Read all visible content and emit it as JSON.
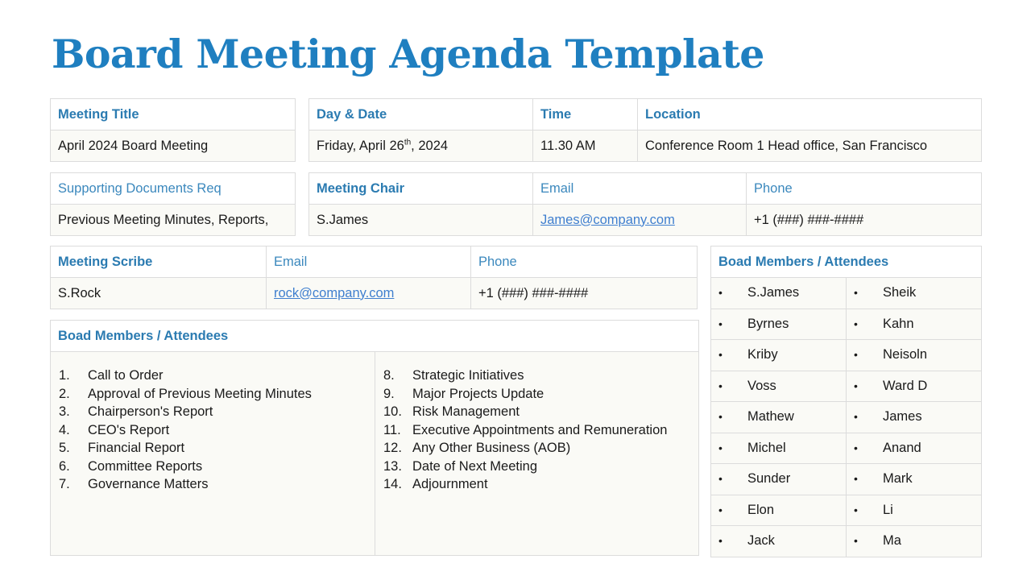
{
  "page": {
    "title": "Board Meeting Agenda Template"
  },
  "meeting_title": {
    "label": "Meeting Title",
    "value": "April  2024 Board Meeting"
  },
  "schedule": {
    "date_label": "Day & Date",
    "date_prefix": "Friday, April 26",
    "date_suffix": "th",
    "date_rest": ", 2024",
    "time_label": "Time",
    "time_value": "11.30 AM",
    "location_label": "Location",
    "location_value": "Conference Room 1 Head office, San Francisco"
  },
  "supporting_docs": {
    "label": "Supporting Documents Req",
    "value": "Previous Meeting Minutes, Reports,"
  },
  "chair": {
    "label": "Meeting Chair",
    "name": "S.James",
    "email_label": "Email",
    "email": "James@company.com",
    "phone_label": "Phone",
    "phone": "+1 (###) ###-####"
  },
  "scribe": {
    "label": "Meeting Scribe",
    "name": "S.Rock",
    "email_label": "Email",
    "email": "rock@company.com",
    "phone_label": "Phone",
    "phone": "+1 (###) ###-####"
  },
  "agenda": {
    "heading": "Boad Members / Attendees",
    "left": [
      {
        "num": "1.",
        "text": "Call to Order"
      },
      {
        "num": "2.",
        "text": "Approval of Previous Meeting Minutes"
      },
      {
        "num": "3.",
        "text": "Chairperson's Report"
      },
      {
        "num": "4.",
        "text": "CEO's Report"
      },
      {
        "num": "5.",
        "text": "Financial Report"
      },
      {
        "num": "6.",
        "text": "Committee Reports"
      },
      {
        "num": "7.",
        "text": "Governance Matters"
      }
    ],
    "right": [
      {
        "num": "8.",
        "text": "Strategic Initiatives"
      },
      {
        "num": "9.",
        "text": "Major Projects Update"
      },
      {
        "num": "10.",
        "text": "Risk Management"
      },
      {
        "num": "11.",
        "text": "Executive Appointments and Remuneration"
      },
      {
        "num": "12.",
        "text": "Any Other Business (AOB)"
      },
      {
        "num": "13.",
        "text": "Date of Next Meeting"
      },
      {
        "num": "14.",
        "text": "Adjournment"
      }
    ]
  },
  "attendees": {
    "heading": "Boad Members / Attendees",
    "bullet": "•",
    "rows": [
      [
        "S.James",
        "Sheik"
      ],
      [
        "Byrnes",
        "Kahn"
      ],
      [
        "Kriby",
        "Neisoln"
      ],
      [
        "Voss",
        "Ward D"
      ],
      [
        "Mathew",
        "James"
      ],
      [
        "Michel",
        "Anand"
      ],
      [
        "Sunder",
        "Mark"
      ],
      [
        "Elon",
        "Li"
      ],
      [
        "Jack",
        "Ma"
      ]
    ]
  },
  "colors": {
    "accent": "#1f7fc0",
    "header_text": "#2b7bb1",
    "link": "#3f7fcf",
    "cell_bg": "#fafaf6",
    "border": "#dcdcdc"
  }
}
